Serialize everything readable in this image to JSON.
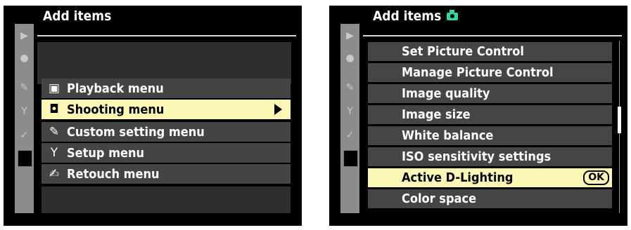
{
  "left": {
    "title": "Add items",
    "menus": [
      {
        "icon": "playback-icon",
        "glyph": "▶",
        "label": "Playback menu"
      },
      {
        "icon": "camera-icon",
        "glyph": "◘",
        "label": "Shooting menu"
      },
      {
        "icon": "pencil-icon",
        "glyph": "✎",
        "label": "Custom setting menu"
      },
      {
        "icon": "wrench-icon",
        "glyph": "Y",
        "label": "Setup menu"
      },
      {
        "icon": "retouch-icon",
        "glyph": "✍",
        "label": "Retouch menu"
      }
    ],
    "selected_index": 1
  },
  "right": {
    "title": "Add items",
    "items": [
      "Set Picture Control",
      "Manage Picture Control",
      "Image quality",
      "Image size",
      "White balance",
      "ISO sensitivity settings",
      "Active D-Lighting",
      "Color space"
    ],
    "selected_index": 6,
    "ok_label": "OK",
    "scroll_position": 0.45
  },
  "sidebar_icons": [
    "playback-icon",
    "camera-icon",
    "pencil-icon",
    "wrench-icon",
    "retouch-icon",
    "my-menu-icon"
  ],
  "colors": {
    "highlight": "#fdf7b5",
    "accent": "#33d4a6",
    "row": "#444444"
  }
}
